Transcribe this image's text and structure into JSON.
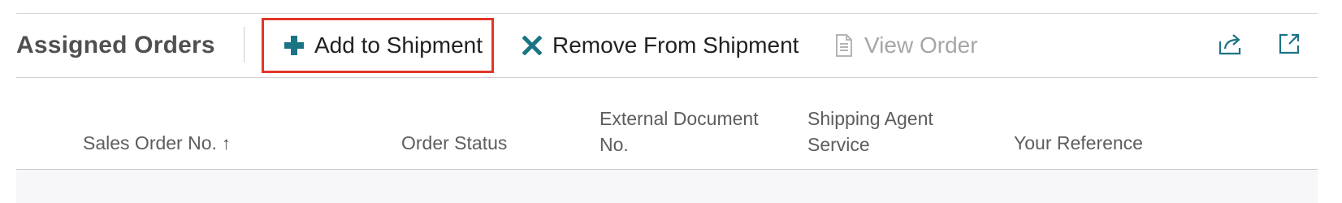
{
  "part": {
    "title": "Assigned Orders"
  },
  "actions": {
    "add_label": "Add to Shipment",
    "remove_label": "Remove From Shipment",
    "view_label": "View Order"
  },
  "icons": {
    "add": "plus-icon",
    "remove": "x-icon",
    "view": "document-icon",
    "share": "share-icon",
    "expand": "expand-icon"
  },
  "columns": [
    {
      "label": "Sales Order No.",
      "sort": "ascending"
    },
    {
      "label": "Order Status"
    },
    {
      "label_line1": "External Document",
      "label_line2": "No."
    },
    {
      "label_line1": "Shipping Agent",
      "label_line2": "Service"
    },
    {
      "label": "Your Reference"
    }
  ],
  "colors": {
    "accent": "#1a7484",
    "highlight_border": "#e1372a",
    "disabled_text": "#a6a6a6"
  }
}
